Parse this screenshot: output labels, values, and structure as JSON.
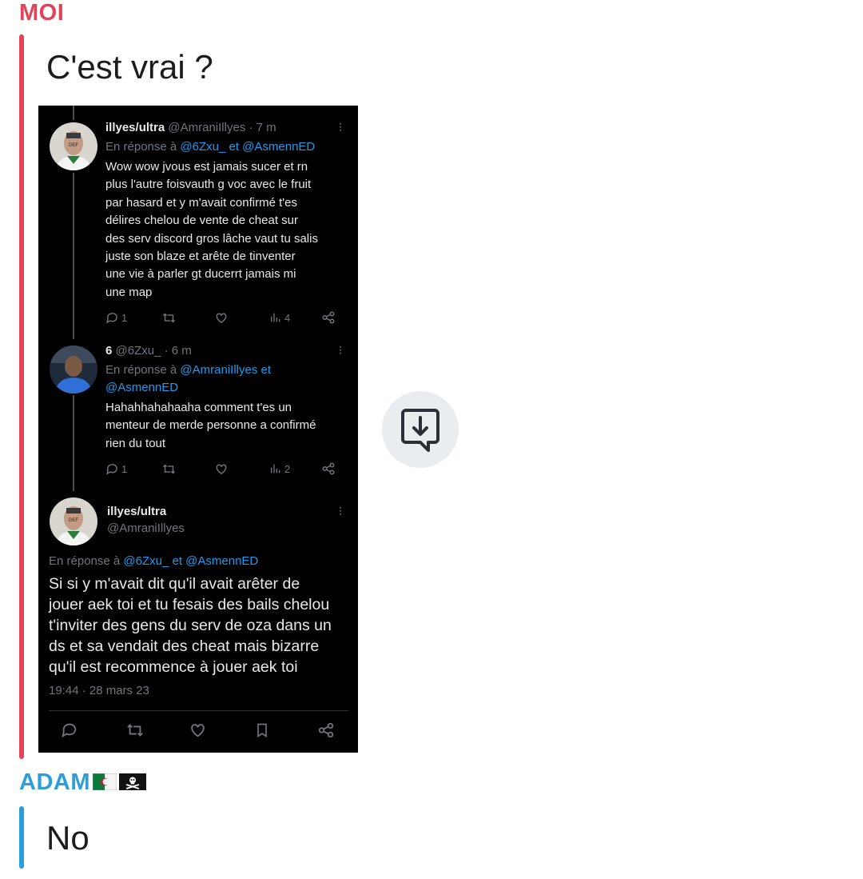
{
  "messages": [
    {
      "sender": "MOI",
      "text": "C'est vrai ?",
      "accent": "#e2425a"
    },
    {
      "sender": "ADAM",
      "text": "No",
      "accent": "#2a9fd8"
    }
  ],
  "screenshot": {
    "tweets": [
      {
        "name": "illyes/ultra",
        "handle": "@AmraniIllyes",
        "time": "· 7 m",
        "reply_prefix": "En réponse à",
        "reply_to": "@6Zxu_ et @AsmennED",
        "body": "Wow wow jvous est jamais sucer et rn\nplus l'autre foisvauth g voc avec le fruit\npar hasard et y m'avait confirmé t'es\ndélires chelou de vente de cheat sur\ndes serv discord gros lâche vaut tu salis\njuste son blaze et arête de tinventer\nune vie à parler gt ducerrt jamais mi\nune map",
        "replies": "1",
        "views": "4"
      },
      {
        "name": "6",
        "handle": "@6Zxu_",
        "time": "· 6 m",
        "reply_prefix": "En réponse à",
        "reply_to_line1": "@AmraniIllyes et",
        "reply_to_line2": "@AsmennED",
        "body": "Hahahhahahaaha comment t'es un\nmenteur de merde personne a confirmé\nrien du tout",
        "replies": "1",
        "views": "2"
      }
    ],
    "main_tweet": {
      "name": "illyes/ultra",
      "handle": "@AmraniIllyes",
      "reply_prefix": "En réponse à",
      "reply_to": "@6Zxu_ et @AsmennED",
      "body": "Si si y m'avait dit qu'il avait arêter de\njouer aek toi et tu fesais des bails chelou\nt'inviter des gens du serv de oza dans un\nds et sa vendait des cheat mais bizarre\nqu'il est recommence à jouer aek toi",
      "timestamp": "19:44 · 28 mars 23"
    }
  },
  "colors": {
    "link": "#1d9bf0",
    "muted": "#71767b",
    "tweet_bg": "#000000"
  },
  "icons": [
    "reply-icon",
    "retweet-icon",
    "like-icon",
    "views-icon",
    "share-icon",
    "bookmark-icon",
    "save-download-icon",
    "algeria-flag-icon",
    "pirate-flag-icon"
  ]
}
